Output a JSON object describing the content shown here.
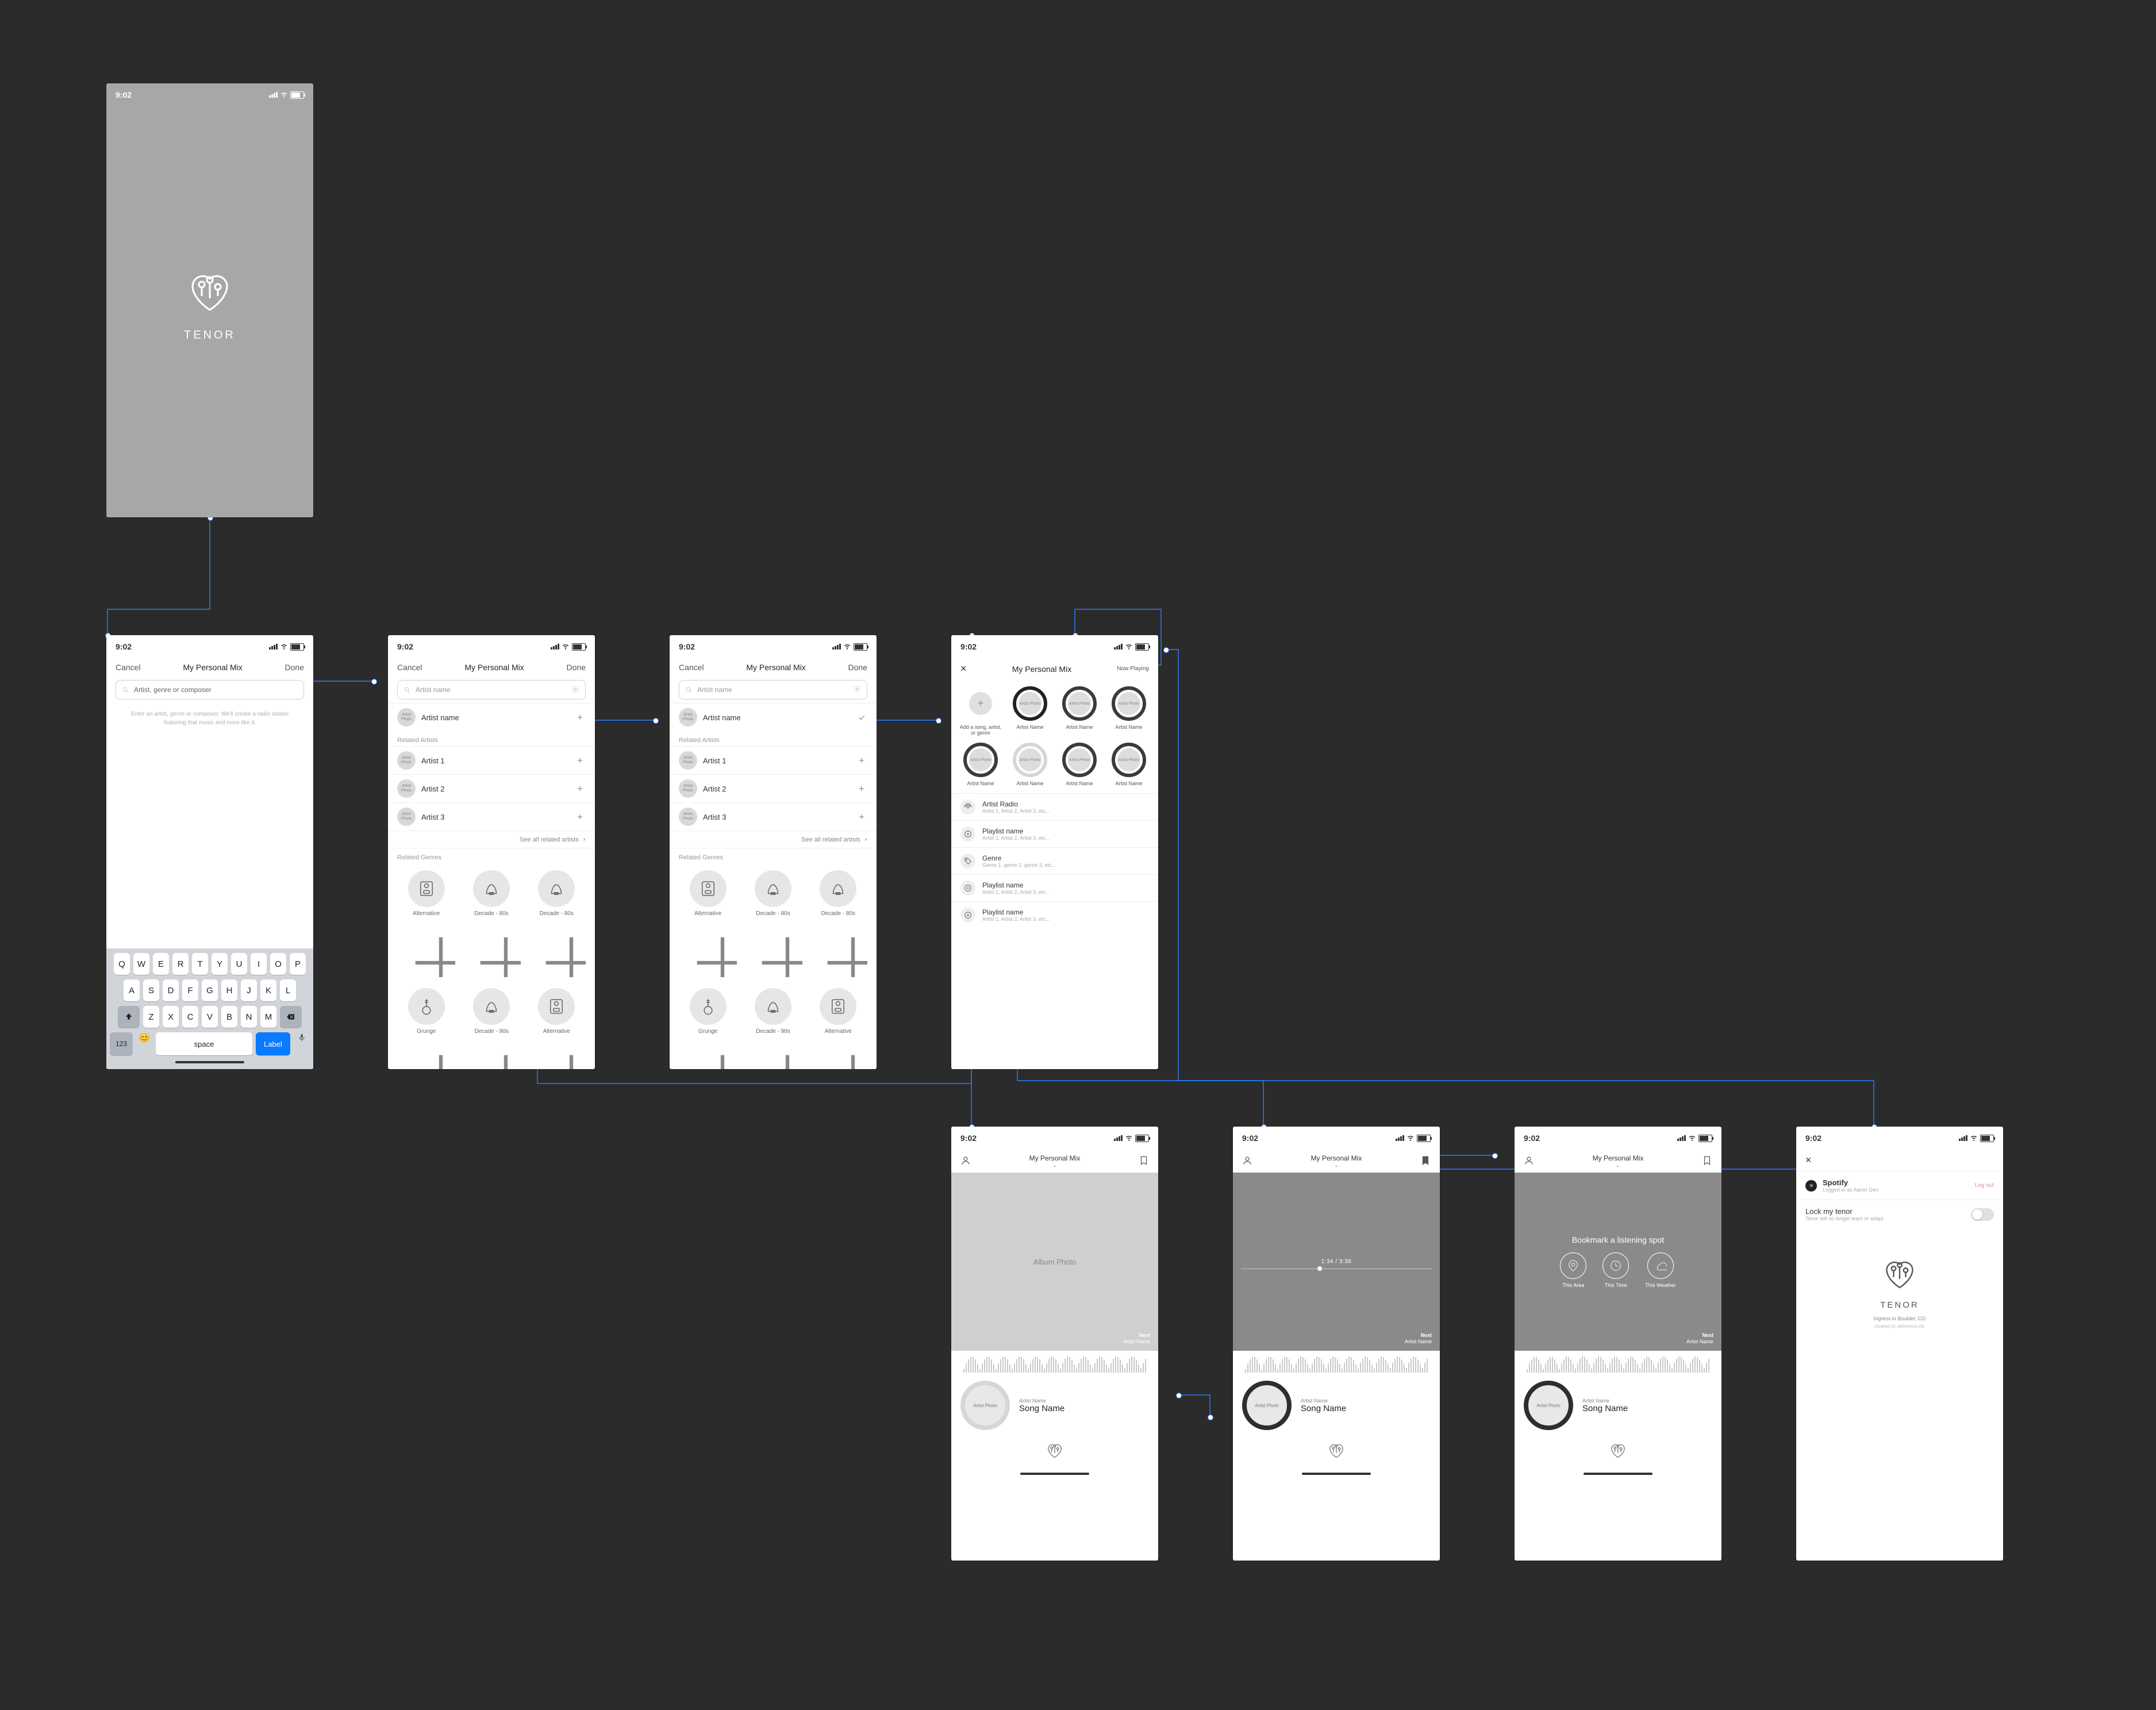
{
  "statusbar": {
    "time": "9:02"
  },
  "brand": {
    "name": "TENOR",
    "location": "Ingress in Boulder, CO",
    "email": "created by delorenzo.etc"
  },
  "nav": {
    "cancel": "Cancel",
    "done": "Done",
    "title_personal": "My Personal Mix",
    "now_playing": "Now Playing"
  },
  "search": {
    "placeholder_long": "Artist, genre or composer",
    "placeholder_short": "Artist name"
  },
  "hint": "Enter an artist, genre or composer. We'll create a radio station featuring that music and more like it.",
  "screen2": {
    "result": "Artist name",
    "related_label": "Related Artists",
    "artists": [
      "Artist 1",
      "Artist 2",
      "Artist 3"
    ],
    "seeall": "See all related artists",
    "genres_label": "Related Genres",
    "genres_row1": [
      "Alternative",
      "Decade - 80s",
      "Decade - 80s"
    ],
    "genres_row2": [
      "Grunge",
      "Decade - 90s",
      "Alternative"
    ]
  },
  "screen4": {
    "bubbles": [
      {
        "label": "Add a song, artist, or genre",
        "add": true,
        "ring": "add"
      },
      {
        "label": "Artist Name",
        "ring": "sel"
      },
      {
        "label": "Artist Name",
        "ring": ""
      },
      {
        "label": "Artist Name",
        "ring": ""
      },
      {
        "label": "Artist Name",
        "ring": ""
      },
      {
        "label": "Artist Name",
        "ring": "light"
      },
      {
        "label": "Artist Name",
        "ring": ""
      },
      {
        "label": "Artist Name",
        "ring": ""
      }
    ],
    "lists": [
      {
        "title": "Artist Radio",
        "sub": "Artist 1, Artist 2, Artist 3, etc...",
        "icon": "radio"
      },
      {
        "title": "Playlist name",
        "sub": "Artist 1, Artist 2, Artist 3, etc...",
        "icon": "disc"
      },
      {
        "title": "Genre",
        "sub": "Genre 1, genre 2, genre 3, etc...",
        "icon": "tag"
      },
      {
        "title": "Playlist name",
        "sub": "Artist 1, Artist 2, Artist 3, etc...",
        "icon": "disc"
      },
      {
        "title": "Playlist name",
        "sub": "Artist 1, Artist 2, Artist 3, etc...",
        "icon": "disc"
      }
    ]
  },
  "player": {
    "album_label": "Album Photo",
    "artist_photo": "Artist Photo",
    "artist_name": "Artist Name",
    "song_name": "Song Name",
    "next": "Next",
    "time": "1:34 / 3:36"
  },
  "bookmark": {
    "title": "Bookmark a listening spot",
    "opts": [
      "This Area",
      "This Time",
      "This Weather"
    ]
  },
  "settings": {
    "spotify": "Spotify",
    "spotify_sub": "Logged in as Aaron Geo",
    "logout": "Log out",
    "lock": "Lock my tenor",
    "lock_sub": "Tenor will no longer learn or adapt"
  },
  "keyboard": {
    "row1": [
      "Q",
      "W",
      "E",
      "R",
      "T",
      "Y",
      "U",
      "I",
      "O",
      "P"
    ],
    "row2": [
      "A",
      "S",
      "D",
      "F",
      "G",
      "H",
      "J",
      "K",
      "L"
    ],
    "row3": [
      "Z",
      "X",
      "C",
      "V",
      "B",
      "N",
      "M"
    ],
    "numkey": "123",
    "space": "space",
    "label": "Label"
  },
  "avatar_label": "Artist Photo"
}
